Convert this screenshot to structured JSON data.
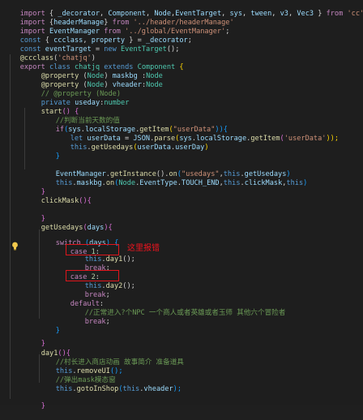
{
  "code": {
    "l1": [
      "import",
      " { ",
      "_decorator",
      ", ",
      "Component",
      ", ",
      "Node",
      ",",
      "EventTarget",
      ", ",
      "sys",
      ", ",
      "tween",
      ", ",
      "v3",
      ", ",
      "Vec3",
      " } ",
      "from",
      " ",
      "'cc'",
      ";"
    ],
    "l2": [
      "import",
      " {",
      "headerManage",
      "} ",
      "from",
      " ",
      "'../header/headerManage'"
    ],
    "l3": [
      "import",
      " ",
      "EventManager",
      " ",
      "from",
      " ",
      "'../global/EventManager'",
      ";"
    ],
    "l4": [
      "const",
      " { ",
      "ccclass",
      ", ",
      "property",
      " } = ",
      "_decorator",
      ";"
    ],
    "l5": [
      "const",
      " ",
      "eventTarget",
      " = ",
      "new",
      " ",
      "EventTarget",
      "();"
    ],
    "l6": [
      "@",
      "ccclass",
      "(",
      "'chatjq'",
      ")"
    ],
    "l7": [
      "export",
      " ",
      "class",
      " ",
      "chatjq",
      " ",
      "extends",
      " ",
      "Component",
      " {"
    ],
    "l8": [
      "@",
      "property",
      " (",
      "Node",
      ") ",
      "maskbg",
      " :",
      "Node"
    ],
    "l9": [
      "@",
      "property",
      " (",
      "Node",
      ") ",
      "vheader",
      ":",
      "Node"
    ],
    "l10": [
      "// @property (Node)"
    ],
    "l11": [
      "private",
      " ",
      "useday",
      ":",
      "number"
    ],
    "l12": [
      "start",
      "() {"
    ],
    "l13": [
      "//判断当前天数的值"
    ],
    "l14": [
      "if",
      "(",
      "sys",
      ".",
      "localStorage",
      ".",
      "getItem",
      "(",
      "\"userData\"",
      ")){"
    ],
    "l15": [
      "let",
      " ",
      "userData",
      " = ",
      "JSON",
      ".",
      "parse",
      "(",
      "sys",
      ".",
      "localStorage",
      ".",
      "getItem",
      "(",
      "'userData'",
      "));"
    ],
    "l16": [
      "this",
      ".",
      "getUsedays",
      "(",
      "userData",
      ".",
      "userDay",
      ")"
    ],
    "l17": [
      "}"
    ],
    "l18": [
      "EventManager",
      ".",
      "getInstance",
      "().",
      "on",
      "(",
      "\"usedays\"",
      ",",
      "this",
      ".",
      "getUsedays",
      ")"
    ],
    "l19": [
      "this",
      ".",
      "maskbg",
      ".",
      "on",
      "(",
      "Node",
      ".",
      "EventType",
      ".",
      "TOUCH_END",
      ",",
      "this",
      ".",
      "clickMask",
      ",",
      "this",
      ")"
    ],
    "l20": [
      "}"
    ],
    "l21": [
      "clickMask",
      "(){"
    ],
    "l22": [
      "}"
    ],
    "l23": [
      "getUsedays",
      "(",
      "days",
      "){"
    ],
    "l24": [
      "switch",
      " (",
      "days",
      ") {"
    ],
    "l25": [
      "case",
      " ",
      "1",
      ":"
    ],
    "l26": [
      "this",
      ".",
      "day1",
      "();"
    ],
    "l27": [
      "break",
      ";"
    ],
    "l28": [
      "case",
      " ",
      "2",
      ":"
    ],
    "l29": [
      "this",
      ".",
      "day2",
      "();"
    ],
    "l30": [
      "break",
      ";"
    ],
    "l31": [
      "default",
      ":"
    ],
    "l32": [
      "//正常进入?个NPC 一个商人或者英雄或者玉师 其他六个冒险者"
    ],
    "l33": [
      "break",
      ";"
    ],
    "l34": [
      "}"
    ],
    "l35": [
      "}"
    ],
    "l36": [
      "day1",
      "(){"
    ],
    "l37": [
      "//村长进入商店动画 故事简介 准备道具"
    ],
    "l38": [
      "this",
      ".",
      "removeUI",
      "();"
    ],
    "l39": [
      "//弹出mask模态窗"
    ],
    "l40": [
      "this",
      ".",
      "gotoInShop",
      "(",
      "this",
      ".",
      "vheader",
      ");"
    ],
    "l41": [
      "}"
    ]
  },
  "annotation": "这里报错",
  "icons": {
    "lightbulb": "lightbulb-icon"
  },
  "colors": {
    "highlight_box": "#e0151b",
    "annotation_text": "#f0141e",
    "background": "#1e1e1e"
  }
}
